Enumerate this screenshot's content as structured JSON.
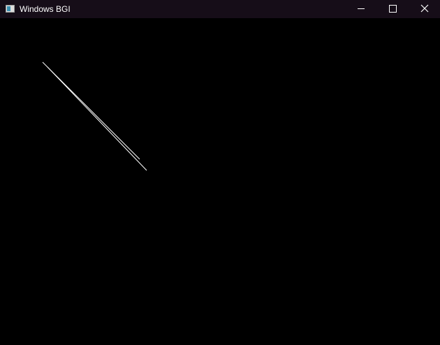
{
  "window": {
    "title": "Windows BGI",
    "controls": {
      "minimize_icon": "minimize-icon",
      "maximize_icon": "maximize-icon",
      "close_icon": "close-icon"
    }
  },
  "colors": {
    "titlebar_bg": "#160d18",
    "canvas_bg": "#000000",
    "line_color": "#ffffff"
  }
}
